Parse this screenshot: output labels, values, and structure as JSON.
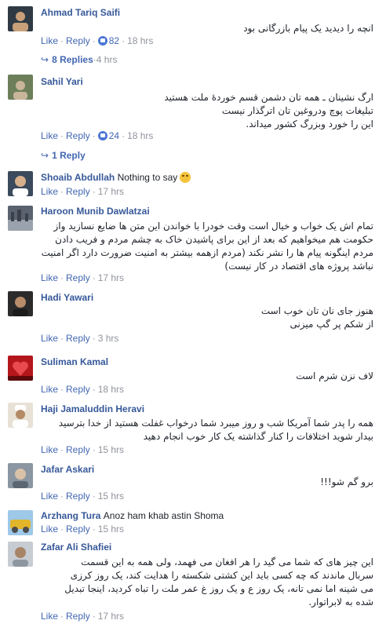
{
  "actions": {
    "like": "Like",
    "reply": "Reply",
    "dot": "·"
  },
  "comments": [
    {
      "author": "Ahmad Tariq Saifi",
      "text": "انچه را دیدید یک پیام بازرگانی بود",
      "likes": "82",
      "time": "18 hrs",
      "replies_label": "8 Replies",
      "replies_time": "4 hrs",
      "avatar_colors": [
        "#2f3a44",
        "#c9a07a"
      ]
    },
    {
      "author": "Sahil Yari",
      "lines": [
        "ارگ نشینان ـ همه تان دشمن قسم خوردهٔ ملت هستید",
        "تبلیغات پوچ ودروغین تان اترگذار نیست",
        "این را خورد وبزرگ کشور میداند."
      ],
      "likes": "24",
      "time": "18 hrs",
      "replies_label": "1 Reply",
      "avatar_colors": [
        "#6d7f5a",
        "#c8b59a"
      ]
    },
    {
      "author": "Shoaib Abdullah",
      "inline_text": "Nothing to say",
      "emoji": "laughing-emoji",
      "time": "17 hrs",
      "avatar_colors": [
        "#3b4a5c",
        "#d8b08c"
      ]
    },
    {
      "author": "Haroon Munib Dawlatzai",
      "lines": [
        "تمام اش یک خواب و خیال است وقت خودرا با خواندن این متن ها ضایع نسازید واز",
        "حکومت هم میخواهیم که بعد از این برای پاشیدن خاک به چشم مردم و فریب دادن",
        "مردم اینگونه پیام ها را نشر نکند (مردم ازهمه بیشتر به امنیت ضرورت دارد اگر امنیت",
        "نباشد پروژه های اقتصاد در کار نیست)"
      ],
      "time": "17 hrs",
      "avatar_colors": [
        "#5a6270",
        "#9aa3ad"
      ]
    },
    {
      "author": "Hadi Yawari",
      "lines": [
        "هنوز جای نان تان خوب است",
        "از شکم پر گپ میزنی"
      ],
      "time": "3 hrs",
      "avatar_colors": [
        "#2b2b2b",
        "#b98c6a"
      ]
    },
    {
      "author": "Suliman Kamal",
      "lines": [
        "لاف نزن شرم است"
      ],
      "time": "18 hrs",
      "avatar_colors": [
        "#b3161b",
        "#5c0a0c"
      ]
    },
    {
      "author": "Haji Jamaluddin Heravi",
      "lines": [
        "همه را پدر شما آمریکا شب و روز میبرد شما درخواب غفلت هستید از خدا بترسید",
        "بیدار شوید اختلافات را کنار گذاشته یک کار خوب انجام دهید"
      ],
      "time": "15 hrs",
      "avatar_colors": [
        "#e8e2d6",
        "#b48a66"
      ]
    },
    {
      "author": "Jafar Askari",
      "lines": [
        "برو گم شو!!!"
      ],
      "time": "15 hrs",
      "avatar_colors": [
        "#8a96a2",
        "#d9c2a8"
      ]
    },
    {
      "author": "Arzhang Tura",
      "inline_text": "Anoz ham khab astin Shoma",
      "time": "15 hrs",
      "avatar_colors": [
        "#e2b52a",
        "#4d4d4d"
      ]
    },
    {
      "author": "Zafar Ali Shafiei",
      "lines": [
        "این چیز های که شما می گید را هر افغان می فهمد، ولی همه به این قسمت",
        "سربال ماندند که چه کسی باید این کشتی شکسته را هدایت کند، یک روز کرزی",
        "می شینه اما نمی تانه، یک روز ع و یک روز غ عمر ملت را تباه کردید، اینجا تبدیل",
        "شده به لابراتوار."
      ],
      "time": "17 hrs",
      "avatar_colors": [
        "#c7ccd2",
        "#a88466"
      ]
    }
  ]
}
